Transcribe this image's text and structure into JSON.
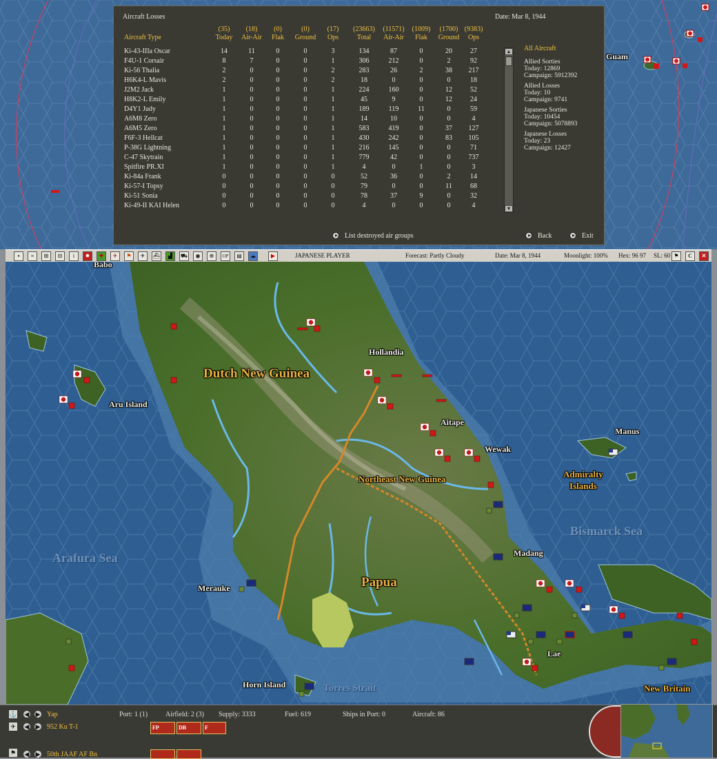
{
  "losses": {
    "title": "Aircraft Losses",
    "date": "Date: Mar 8, 1944",
    "type_header": "Aircraft Type",
    "columns": [
      {
        "total": "(35)",
        "label": "Today"
      },
      {
        "total": "(18)",
        "label": "Air-Air"
      },
      {
        "total": "(0)",
        "label": "Flak"
      },
      {
        "total": "(0)",
        "label": "Ground"
      },
      {
        "total": "(17)",
        "label": "Ops"
      },
      {
        "total": "(23663)",
        "label": "Total"
      },
      {
        "total": "(11571)",
        "label": "Air-Air"
      },
      {
        "total": "(1009)",
        "label": "Flak"
      },
      {
        "total": "(1700)",
        "label": "Ground"
      },
      {
        "total": "(9383)",
        "label": "Ops"
      }
    ],
    "rows": [
      {
        "name": "Ki-43-IIIa Oscar",
        "v": [
          "14",
          "11",
          "0",
          "0",
          "3",
          "134",
          "87",
          "0",
          "20",
          "27"
        ]
      },
      {
        "name": "F4U-1 Corsair",
        "v": [
          "8",
          "7",
          "0",
          "0",
          "1",
          "306",
          "212",
          "0",
          "2",
          "92"
        ]
      },
      {
        "name": "Ki-56 Thalia",
        "v": [
          "2",
          "0",
          "0",
          "0",
          "2",
          "283",
          "26",
          "2",
          "38",
          "217"
        ]
      },
      {
        "name": "H6K4-L Mavis",
        "v": [
          "2",
          "0",
          "0",
          "0",
          "2",
          "18",
          "0",
          "0",
          "0",
          "18"
        ]
      },
      {
        "name": "J2M2 Jack",
        "v": [
          "1",
          "0",
          "0",
          "0",
          "1",
          "224",
          "160",
          "0",
          "12",
          "52"
        ]
      },
      {
        "name": "H8K2-L Emily",
        "v": [
          "1",
          "0",
          "0",
          "0",
          "1",
          "45",
          "9",
          "0",
          "12",
          "24"
        ]
      },
      {
        "name": "D4Y1 Judy",
        "v": [
          "1",
          "0",
          "0",
          "0",
          "1",
          "189",
          "119",
          "11",
          "0",
          "59"
        ]
      },
      {
        "name": "A6M8 Zero",
        "v": [
          "1",
          "0",
          "0",
          "0",
          "1",
          "14",
          "10",
          "0",
          "0",
          "4"
        ]
      },
      {
        "name": "A6M5 Zero",
        "v": [
          "1",
          "0",
          "0",
          "0",
          "1",
          "583",
          "419",
          "0",
          "37",
          "127"
        ]
      },
      {
        "name": "F6F-3 Hellcat",
        "v": [
          "1",
          "0",
          "0",
          "0",
          "1",
          "430",
          "242",
          "0",
          "83",
          "105"
        ]
      },
      {
        "name": "P-38G Lightning",
        "v": [
          "1",
          "0",
          "0",
          "0",
          "1",
          "216",
          "145",
          "0",
          "0",
          "71"
        ]
      },
      {
        "name": "C-47 Skytrain",
        "v": [
          "1",
          "0",
          "0",
          "0",
          "1",
          "779",
          "42",
          "0",
          "0",
          "737"
        ]
      },
      {
        "name": "Spitfire PR.XI",
        "v": [
          "1",
          "0",
          "0",
          "0",
          "1",
          "4",
          "0",
          "1",
          "0",
          "3"
        ]
      },
      {
        "name": "Ki-84a Frank",
        "v": [
          "0",
          "0",
          "0",
          "0",
          "0",
          "52",
          "36",
          "0",
          "2",
          "14"
        ]
      },
      {
        "name": "Ki-57-I Topsy",
        "v": [
          "0",
          "0",
          "0",
          "0",
          "0",
          "79",
          "0",
          "0",
          "11",
          "68"
        ]
      },
      {
        "name": "Ki-51 Sonia",
        "v": [
          "0",
          "0",
          "0",
          "0",
          "0",
          "78",
          "37",
          "9",
          "0",
          "32"
        ]
      },
      {
        "name": "Ki-49-II KAI Helen",
        "v": [
          "0",
          "0",
          "0",
          "0",
          "0",
          "4",
          "0",
          "0",
          "0",
          "4"
        ]
      }
    ],
    "side": {
      "all_aircraft": "All Aircraft",
      "allied_sorties": "Allied Sorties",
      "allied_sorties_today": "Today:   12869",
      "allied_sorties_campaign": "Campaign: 5912392",
      "allied_losses": "Allied Losses",
      "allied_losses_today": "Today:   10",
      "allied_losses_campaign": "Campaign: 9741",
      "japanese_sorties": "Japanese Sorties",
      "japanese_sorties_today": "Today:   10454",
      "japanese_sorties_campaign": "Campaign: 5078893",
      "japanese_losses": "Japanese Losses",
      "japanese_losses_today": "Today:   23",
      "japanese_losses_campaign": "Campaign: 12427"
    },
    "list_destroyed": "List destroyed air groups",
    "back": "Back",
    "exit": "Exit"
  },
  "top_map": {
    "guam_label": "Guam"
  },
  "toolbar": {
    "player": "JAPANESE PLAYER",
    "forecast": "Forecast: Partly Cloudy",
    "date": "Date: Mar 8, 1944",
    "moonlight": "Moonlight: 100%",
    "hex": "Hex: 96 97",
    "sl": "SL: 60",
    "c_button": "C"
  },
  "map": {
    "labels": {
      "babo": "Babo",
      "hollandia": "Hollandia",
      "dutch_new_guinea": "Dutch New Guinea",
      "aru_island": "Aru Island",
      "aitape": "Aitape",
      "wewak": "Wewak",
      "manus": "Manus",
      "northeast_new_guinea": "Northeast New Guinea",
      "admiralty_islands": "Admiralty\nIslands",
      "bismarck_sea": "Bismarck Sea",
      "arafura_sea": "Arafura Sea",
      "madang": "Madang",
      "merauke": "Merauke",
      "papua": "Papua",
      "lae": "Lae",
      "horn_island": "Horn Island",
      "torres_strait": "Torres Strait",
      "new_britain": "New Britain"
    }
  },
  "bottom": {
    "base_name": "Yap",
    "port": "Port: 1 (1)",
    "airfield": "Airfield: 2 (3)",
    "supply": "Supply: 3333",
    "fuel": "Fuel: 619",
    "ships_in_port": "Ships in Port: 0",
    "aircraft": "Aircraft: 86",
    "air_unit": "952 Ku T-1",
    "ground_unit": "50th JAAF AF Bn",
    "icons": [
      "FP",
      "DB",
      "F"
    ]
  },
  "colors": {
    "gold_text": "#f0c040",
    "japanese_red": "#d01818",
    "ocean": "#2f5f92",
    "land": "#4a6e2a"
  }
}
